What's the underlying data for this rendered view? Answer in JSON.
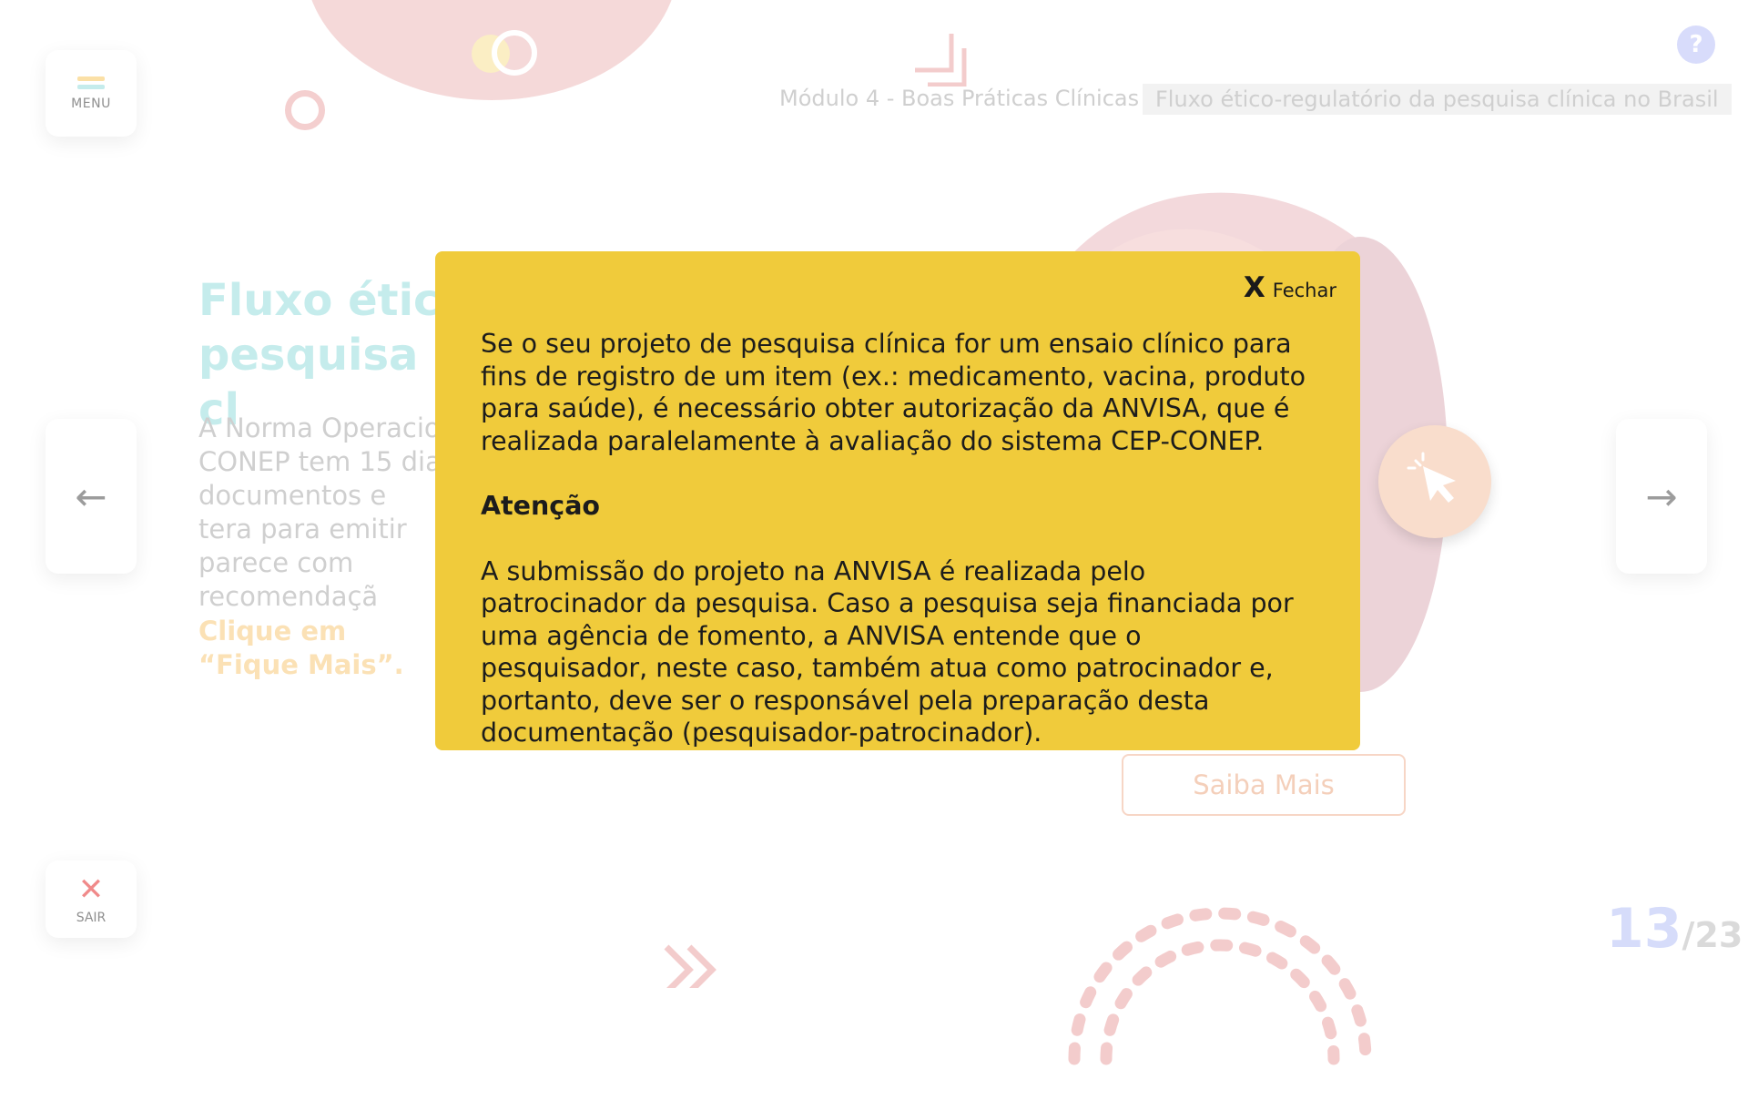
{
  "header": {
    "module": "Módulo 4 - Boas Práticas Clínicas",
    "topic": "Fluxo ético-regulatório da pesquisa clínica no Brasil",
    "help_label": "?"
  },
  "sidebar": {
    "menu_label": "MENU",
    "exit_label": "SAIR",
    "exit_icon": "✕",
    "prev_icon": "←",
    "next_icon": "→"
  },
  "content": {
    "title": "Fluxo ético pesquisa cl",
    "body": "A Norma Operacio CONEP tem 15 dia documentos e tera para emitir parece com recomendaçã",
    "cta": "Clique em “Fique Mais”.",
    "more_button": "Saiba Mais"
  },
  "pagination": {
    "current": "13",
    "total": "/23"
  },
  "modal": {
    "close_icon": "X",
    "close_label": "Fechar",
    "paragraph1": "Se o seu projeto de pesquisa clínica for um ensaio clínico para fins de registro de um item (ex.: medicamento, vacina, produto para saúde), é necessário obter autorização da ANVISA, que é realizada paralelamente à avaliação do sistema CEP-CONEP.",
    "heading": "Atenção",
    "paragraph2": "A submissão do projeto na ANVISA é realizada pelo patrocinador da pesquisa. Caso a pesquisa seja financiada por uma agência de fomento, a ANVISA entende que o pesquisador, neste caso, também atua como patrocinador e, portanto, deve ser o responsável pela preparação desta documentação (pesquisador-patrocinador)."
  },
  "colors": {
    "modal_bg": "#f0cb3b",
    "accent_pink": "#f3d9dc",
    "title_teal": "#c5ecec"
  }
}
